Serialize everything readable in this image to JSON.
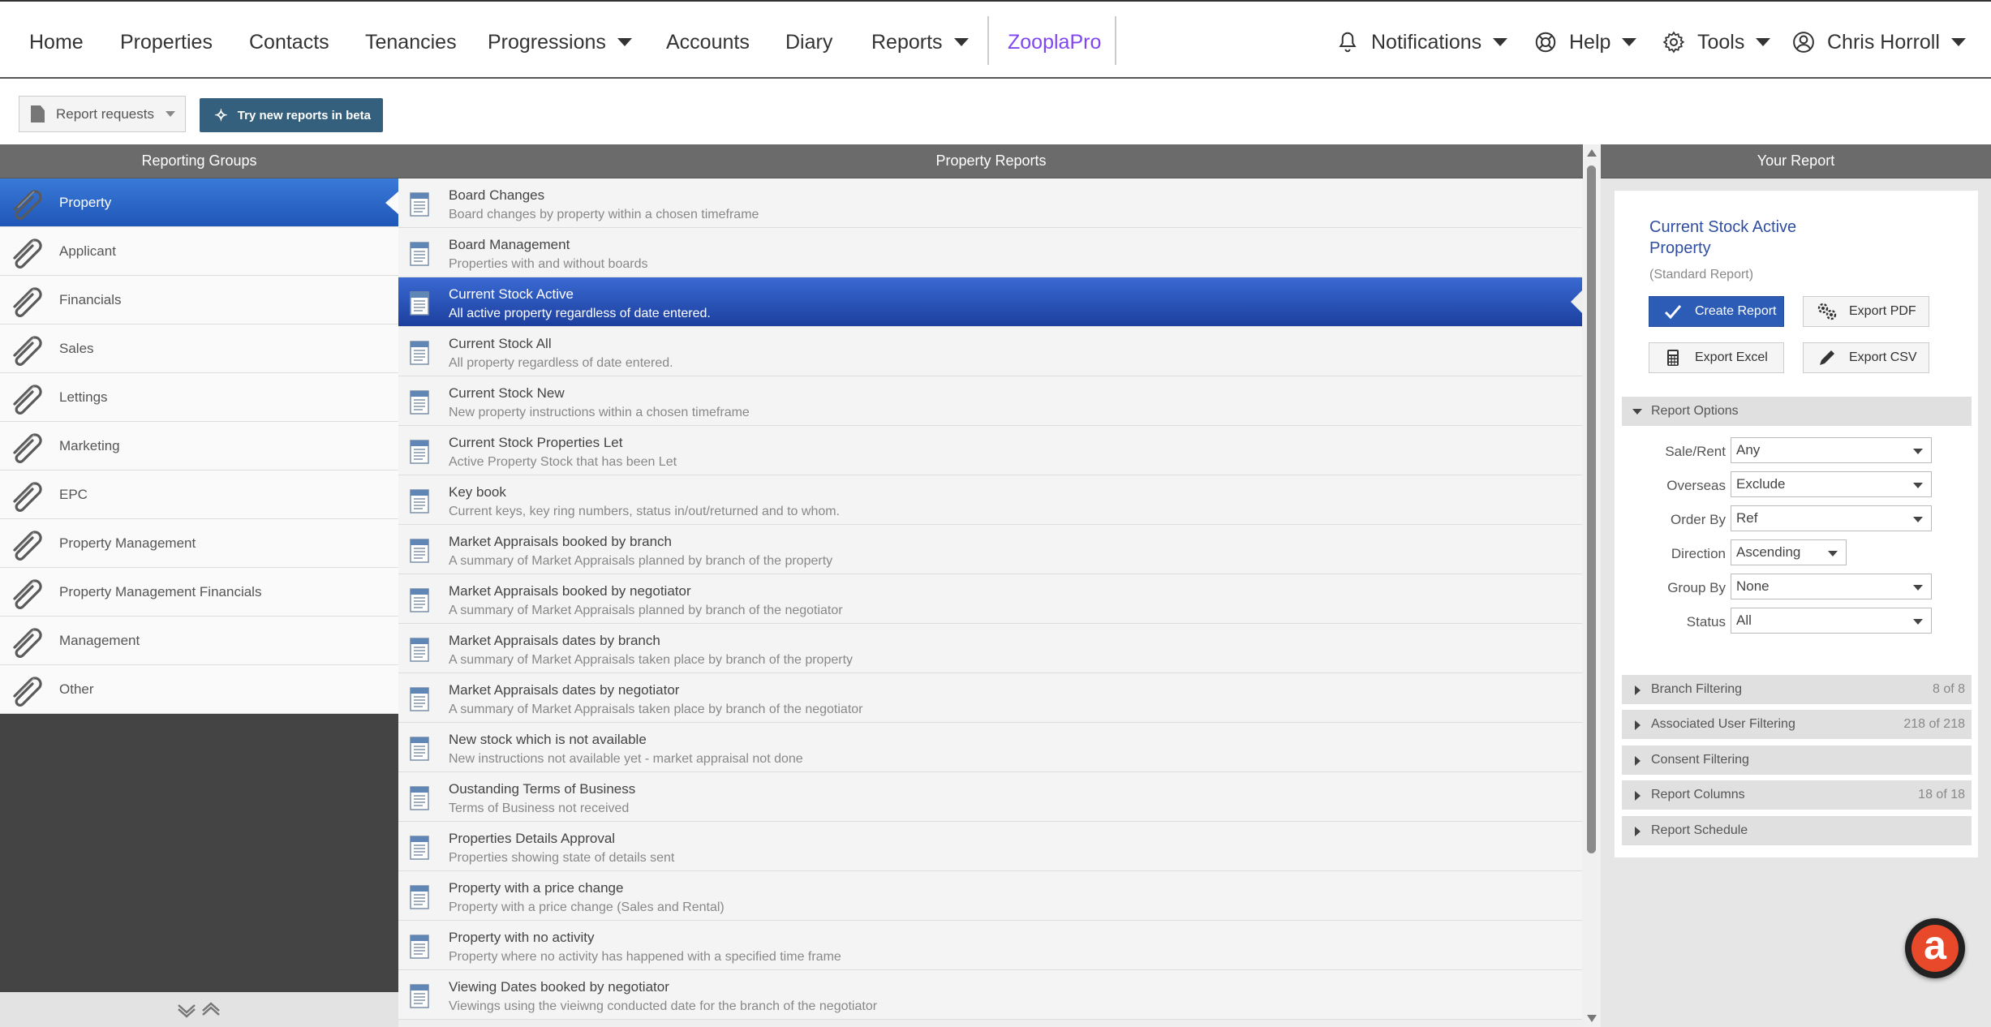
{
  "nav": {
    "home": "Home",
    "properties": "Properties",
    "contacts": "Contacts",
    "tenancies": "Tenancies",
    "progressions": "Progressions",
    "accounts": "Accounts",
    "diary": "Diary",
    "reports": "Reports",
    "zooplapro": "ZooplaPro",
    "notifications": "Notifications",
    "help": "Help",
    "tools": "Tools",
    "user": "Chris Horroll",
    "zooplapro_color": "#8046f1"
  },
  "toolbar": {
    "report_requests": "Report requests",
    "beta_label": "Try new reports in beta"
  },
  "left": {
    "header": "Reporting Groups",
    "groups": [
      {
        "label": "Property",
        "active": true
      },
      {
        "label": "Applicant"
      },
      {
        "label": "Financials"
      },
      {
        "label": "Sales"
      },
      {
        "label": "Lettings"
      },
      {
        "label": "Marketing"
      },
      {
        "label": "EPC"
      },
      {
        "label": "Property Management"
      },
      {
        "label": "Property Management Financials"
      },
      {
        "label": "Management"
      },
      {
        "label": "Other"
      }
    ]
  },
  "middle": {
    "header": "Property Reports",
    "reports": [
      {
        "title": "Board Changes",
        "desc": "Board changes by property within a chosen timeframe"
      },
      {
        "title": "Board Management",
        "desc": "Properties with and without boards"
      },
      {
        "title": "Current Stock Active",
        "desc": "All active property regardless of date entered.",
        "active": true
      },
      {
        "title": "Current Stock All",
        "desc": "All property regardless of date entered."
      },
      {
        "title": "Current Stock New",
        "desc": "New property instructions within a chosen timeframe"
      },
      {
        "title": "Current Stock Properties Let",
        "desc": "Active Property Stock that has been Let"
      },
      {
        "title": "Key book",
        "desc": "Current keys, key ring numbers, status in/out/returned and to whom."
      },
      {
        "title": "Market Appraisals booked by branch",
        "desc": "A summary of Market Appraisals planned by branch of the property"
      },
      {
        "title": "Market Appraisals booked by negotiator",
        "desc": "A summary of Market Appraisals planned by branch of the negotiator"
      },
      {
        "title": "Market Appraisals dates by branch",
        "desc": "A summary of Market Appraisals taken place by branch of the property"
      },
      {
        "title": "Market Appraisals dates by negotiator",
        "desc": "A summary of Market Appraisals taken place by branch of the negotiator"
      },
      {
        "title": "New stock which is not available",
        "desc": "New instructions not available yet - market appraisal not done"
      },
      {
        "title": "Oustanding Terms of Business",
        "desc": "Terms of Business not received"
      },
      {
        "title": "Properties Details Approval",
        "desc": "Properties showing state of details sent"
      },
      {
        "title": "Property with a price change",
        "desc": "Property with a price change (Sales and Rental)"
      },
      {
        "title": "Property with no activity",
        "desc": "Property where no activity has happened with a specified time frame"
      },
      {
        "title": "Viewing Dates booked by negotiator",
        "desc": "Viewings using the vieiwng conducted date for the branch of the negotiator"
      }
    ]
  },
  "right": {
    "header": "Your Report",
    "report_title": "Current Stock Active Property",
    "report_type": "(Standard Report)",
    "create": "Create Report",
    "export_pdf": "Export PDF",
    "export_excel": "Export Excel",
    "export_csv": "Export CSV",
    "report_options": "Report Options",
    "options": {
      "sale_rent": {
        "label": "Sale/Rent",
        "value": "Any"
      },
      "overseas": {
        "label": "Overseas",
        "value": "Exclude"
      },
      "order_by": {
        "label": "Order By",
        "value": "Ref"
      },
      "direction": {
        "label": "Direction",
        "value": "Ascending"
      },
      "group_by": {
        "label": "Group By",
        "value": "None"
      },
      "status": {
        "label": "Status",
        "value": "All"
      }
    },
    "sections": {
      "branch": {
        "label": "Branch Filtering",
        "count": "8 of 8"
      },
      "assoc_user": {
        "label": "Associated User Filtering",
        "count": "218 of 218"
      },
      "consent": {
        "label": "Consent Filtering"
      },
      "columns": {
        "label": "Report Columns",
        "count": "18 of 18"
      },
      "schedule": {
        "label": "Report Schedule"
      }
    }
  },
  "chat": {
    "letter": "a"
  }
}
